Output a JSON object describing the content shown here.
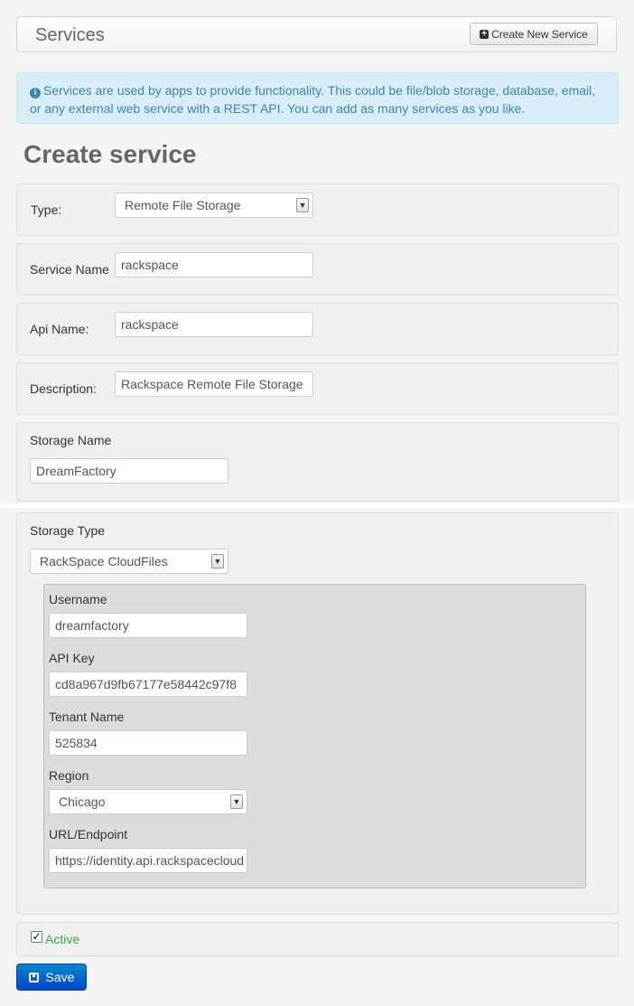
{
  "header": {
    "title": "Services",
    "create_button": "Create New Service"
  },
  "info": {
    "text": "Services are used by apps to provide functionality. This could be file/blob storage, database, email, or any external web service with a REST API. You can add as many services as you like."
  },
  "page_title": "Create service",
  "form": {
    "type": {
      "label": "Type:",
      "value": "Remote File Storage"
    },
    "service_name": {
      "label": "Service Name",
      "value": "rackspace"
    },
    "api_name": {
      "label": "Api Name:",
      "value": "rackspace"
    },
    "description": {
      "label": "Description:",
      "value": "Rackspace Remote File Storage"
    },
    "storage_name": {
      "label": "Storage Name",
      "value": "DreamFactory"
    },
    "storage_type": {
      "label": "Storage Type",
      "value": "RackSpace CloudFiles"
    },
    "username": {
      "label": "Username",
      "value": "dreamfactory"
    },
    "api_key": {
      "label": "API Key",
      "value": "cd8a967d9fb67177e58442c97f8"
    },
    "tenant_name": {
      "label": "Tenant Name",
      "value": "525834"
    },
    "region": {
      "label": "Region",
      "value": "Chicago"
    },
    "url": {
      "label": "URL/Endpoint",
      "value": "https://identity.api.rackspacecloud"
    },
    "active": {
      "label": "Active",
      "checked": true
    }
  },
  "save_button": "Save",
  "icons": {
    "create": "plus-square-icon",
    "info": "info-circle-icon",
    "save": "floppy-disk-icon",
    "checkbox": "check-icon"
  },
  "colors": {
    "primary_button": "#0055cc",
    "info_bg": "#d9edf7",
    "info_text": "#3a87ad",
    "active_text": "#46a546"
  }
}
